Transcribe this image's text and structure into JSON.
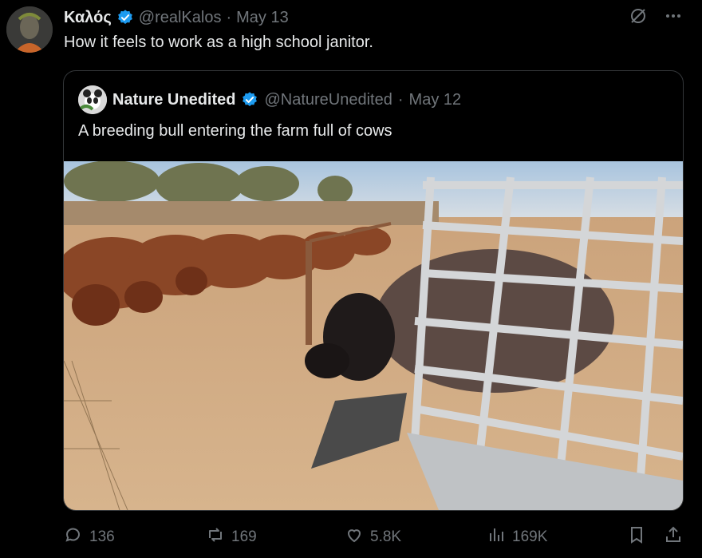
{
  "tweet": {
    "display_name": "Καλός",
    "handle": "@realKalos",
    "date": "May 13",
    "text": "How it feels to work as a high school janitor."
  },
  "quoted": {
    "display_name": "Nature Unedited",
    "handle": "@NatureUnedited",
    "date": "May 12",
    "text": "A breeding bull entering the farm full of cows"
  },
  "actions": {
    "replies": "136",
    "reposts": "169",
    "likes": "5.8K",
    "views": "169K"
  },
  "colors": {
    "verified": "#1d9bf0",
    "muted": "#71767b",
    "text": "#e7e9ea"
  },
  "icons": [
    "grok-icon",
    "more-icon",
    "reply-icon",
    "repost-icon",
    "like-icon",
    "views-icon",
    "bookmark-icon",
    "share-icon"
  ]
}
